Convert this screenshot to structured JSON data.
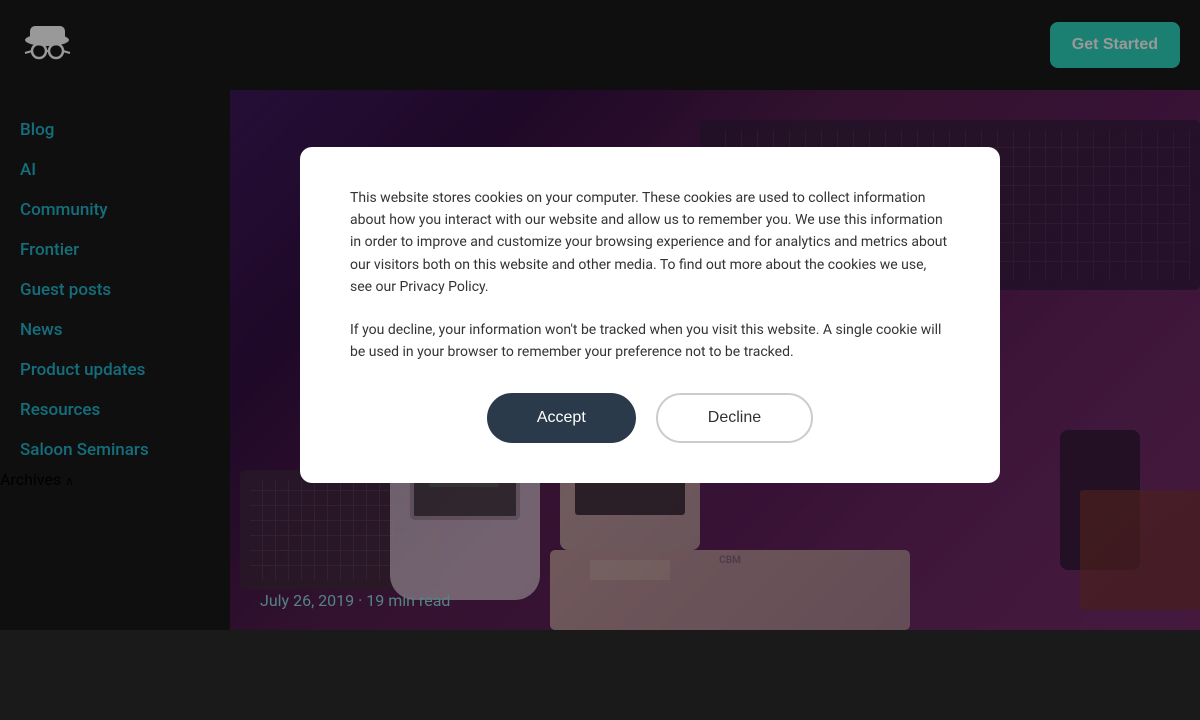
{
  "header": {
    "get_started_label": "Get Started"
  },
  "sidebar": {
    "nav_items": [
      {
        "label": "Blog",
        "id": "blog"
      },
      {
        "label": "AI",
        "id": "ai"
      },
      {
        "label": "Community",
        "id": "community"
      },
      {
        "label": "Frontier",
        "id": "frontier"
      },
      {
        "label": "Guest posts",
        "id": "guest-posts"
      },
      {
        "label": "News",
        "id": "news"
      },
      {
        "label": "Product updates",
        "id": "product-updates"
      },
      {
        "label": "Resources",
        "id": "resources"
      },
      {
        "label": "Saloon Seminars",
        "id": "saloon-seminars"
      }
    ],
    "archives_label": "Archives",
    "archives_chevron": "∧"
  },
  "article": {
    "meta": "July 26, 2019 · 19 min read"
  },
  "cookie": {
    "text1": "This website stores cookies on your computer. These cookies are used to collect information about how you interact with our website and allow us to remember you. We use this information in order to improve and customize your browsing experience and for analytics and metrics about our visitors both on this website and other media. To find out more about the cookies we use, see our Privacy Policy.",
    "text2": "If you decline, your information won't be tracked when you visit this website. A single cookie will be used in your browser to remember your preference not to be tracked.",
    "accept_label": "Accept",
    "decline_label": "Decline"
  }
}
